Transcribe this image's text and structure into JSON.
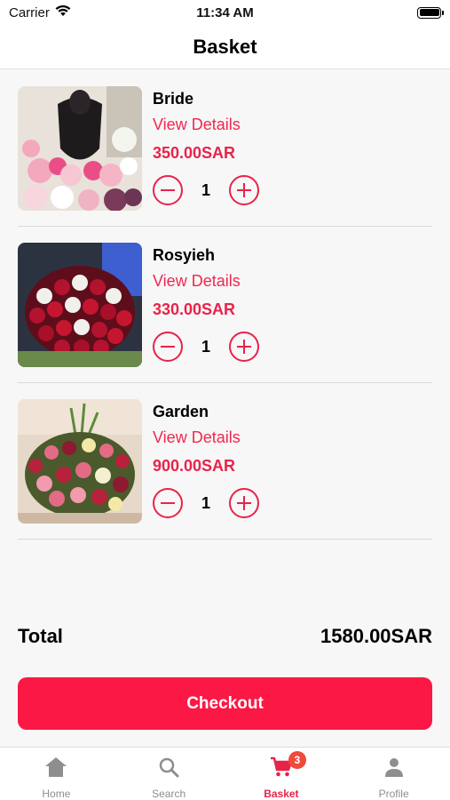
{
  "status_bar": {
    "carrier": "Carrier",
    "time": "11:34 AM",
    "icons": [
      "wifi-icon",
      "battery-icon"
    ]
  },
  "nav": {
    "title": "Basket"
  },
  "items": [
    {
      "name": "Bride",
      "details_label": "View Details",
      "price": "350.00SAR",
      "quantity": "1",
      "image": "bouquet-bride"
    },
    {
      "name": "Rosyieh",
      "details_label": "View Details",
      "price": "330.00SAR",
      "quantity": "1",
      "image": "bouquet-roses"
    },
    {
      "name": "Garden",
      "details_label": "View Details",
      "price": "900.00SAR",
      "quantity": "1",
      "image": "bouquet-garden"
    }
  ],
  "total": {
    "label": "Total",
    "value": "1580.00SAR"
  },
  "checkout": {
    "label": "Checkout"
  },
  "tabs": [
    {
      "label": "Home",
      "icon": "home-icon",
      "active": false
    },
    {
      "label": "Search",
      "icon": "search-icon",
      "active": false
    },
    {
      "label": "Basket",
      "icon": "cart-icon",
      "active": true,
      "badge": "3"
    },
    {
      "label": "Profile",
      "icon": "person-icon",
      "active": false
    }
  ],
  "colors": {
    "accent": "#e8234a",
    "checkout_bg": "#fb1844",
    "badge": "#f04a3b",
    "inactive_tab": "#8e8e8e"
  }
}
